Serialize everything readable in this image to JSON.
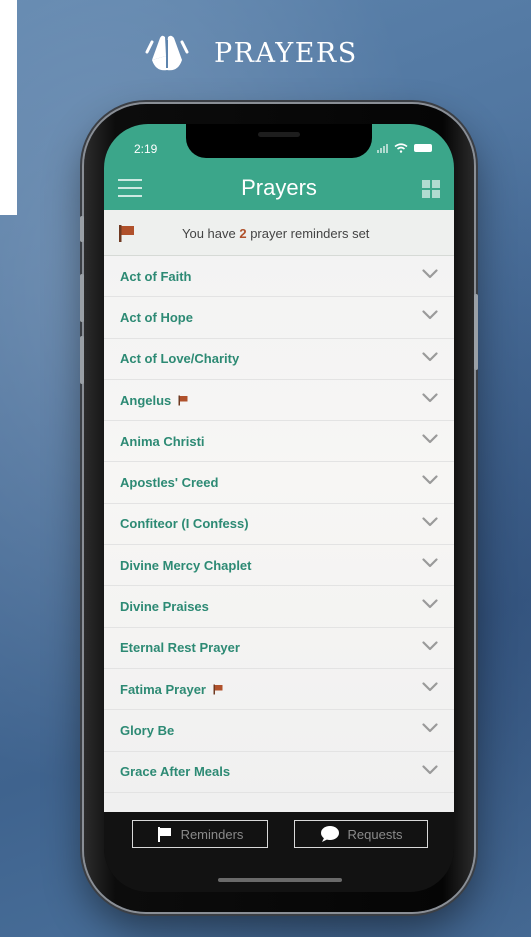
{
  "hero": {
    "title": "PRAYERS",
    "icon": "praying-hands-icon"
  },
  "status_bar": {
    "time": "2:19"
  },
  "app_bar": {
    "title": "Prayers"
  },
  "reminder_banner": {
    "prefix": "You have ",
    "count": "2",
    "suffix": " prayer reminders set"
  },
  "prayers": [
    {
      "label": "Act of Faith",
      "flagged": false
    },
    {
      "label": "Act of Hope",
      "flagged": false
    },
    {
      "label": "Act of Love/Charity",
      "flagged": false
    },
    {
      "label": "Angelus",
      "flagged": true
    },
    {
      "label": "Anima Christi",
      "flagged": false
    },
    {
      "label": "Apostles' Creed",
      "flagged": false
    },
    {
      "label": "Confiteor (I Confess)",
      "flagged": false
    },
    {
      "label": "Divine Mercy Chaplet",
      "flagged": false
    },
    {
      "label": "Divine Praises",
      "flagged": false
    },
    {
      "label": "Eternal Rest Prayer",
      "flagged": false
    },
    {
      "label": "Fatima Prayer",
      "flagged": true
    },
    {
      "label": "Glory Be",
      "flagged": false
    },
    {
      "label": "Grace After Meals",
      "flagged": false
    }
  ],
  "bottom_bar": {
    "reminders_label": "Reminders",
    "requests_label": "Requests"
  },
  "colors": {
    "accent": "#3ba68a",
    "prayer_text": "#2d8a74",
    "flag": "#b0512b"
  }
}
